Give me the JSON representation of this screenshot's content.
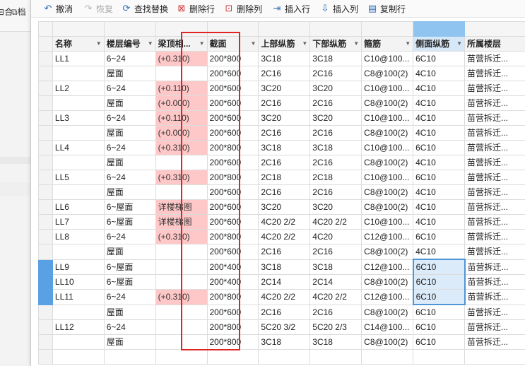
{
  "left_window": {
    "icon1_glyph": "⊟",
    "icon1_char": "合",
    "icon2_glyph": "⧉",
    "icon2_char": "档"
  },
  "toolbar": {
    "undo_label": "撤消",
    "redo_label": "恢复",
    "find_replace_label": "查找替换",
    "delete_row_label": "删除行",
    "delete_col_label": "删除列",
    "insert_row_label": "插入行",
    "insert_col_label": "插入列",
    "copy_row_label": "复制行"
  },
  "grid": {
    "columns": [
      "名称",
      "楼层编号",
      "梁顶相...",
      "截面",
      "上部纵筋",
      "下部纵筋",
      "箍筋",
      "侧面纵筋",
      "所属楼层"
    ],
    "rows": [
      {
        "name": "LL1",
        "floor": "6~24",
        "top_offset": "(+0.310)",
        "section": "200*800",
        "top_bar": "3C18",
        "bottom_bar": "3C18",
        "stirrup": "C10@100...",
        "side_bar": "6C10",
        "belong": "苗营拆迁..."
      },
      {
        "name": "",
        "floor": "屋面",
        "top_offset": "",
        "section": "200*600",
        "top_bar": "2C16",
        "bottom_bar": "2C16",
        "stirrup": "C8@100(2)",
        "side_bar": "4C10",
        "belong": "苗营拆迁..."
      },
      {
        "name": "LL2",
        "floor": "6~24",
        "top_offset": "(+0.110)",
        "section": "200*600",
        "top_bar": "3C20",
        "bottom_bar": "3C20",
        "stirrup": "C10@100...",
        "side_bar": "4C10",
        "belong": "苗营拆迁..."
      },
      {
        "name": "",
        "floor": "屋面",
        "top_offset": "(+0.000)",
        "section": "200*600",
        "top_bar": "2C16",
        "bottom_bar": "2C16",
        "stirrup": "C8@100(2)",
        "side_bar": "4C10",
        "belong": "苗营拆迁..."
      },
      {
        "name": "LL3",
        "floor": "6~24",
        "top_offset": "(+0.110)",
        "section": "200*600",
        "top_bar": "3C20",
        "bottom_bar": "3C20",
        "stirrup": "C10@100...",
        "side_bar": "4C10",
        "belong": "苗营拆迁..."
      },
      {
        "name": "",
        "floor": "屋面",
        "top_offset": "(+0.000)",
        "section": "200*600",
        "top_bar": "2C16",
        "bottom_bar": "2C16",
        "stirrup": "C8@100(2)",
        "side_bar": "4C10",
        "belong": "苗营拆迁..."
      },
      {
        "name": "LL4",
        "floor": "6~24",
        "top_offset": "(+0.310)",
        "section": "200*800",
        "top_bar": "3C18",
        "bottom_bar": "3C18",
        "stirrup": "C10@100...",
        "side_bar": "6C10",
        "belong": "苗营拆迁..."
      },
      {
        "name": "",
        "floor": "屋面",
        "top_offset": "",
        "section": "200*600",
        "top_bar": "2C16",
        "bottom_bar": "2C16",
        "stirrup": "C8@100(2)",
        "side_bar": "4C10",
        "belong": "苗营拆迁..."
      },
      {
        "name": "LL5",
        "floor": "6~24",
        "top_offset": "(+0.310)",
        "section": "200*800",
        "top_bar": "2C18",
        "bottom_bar": "2C18",
        "stirrup": "C10@100...",
        "side_bar": "6C10",
        "belong": "苗营拆迁..."
      },
      {
        "name": "",
        "floor": "屋面",
        "top_offset": "",
        "section": "200*600",
        "top_bar": "2C16",
        "bottom_bar": "2C16",
        "stirrup": "C8@100(2)",
        "side_bar": "4C10",
        "belong": "苗营拆迁..."
      },
      {
        "name": "LL6",
        "floor": "6~屋面",
        "top_offset": "详楼梯图",
        "section": "200*600",
        "top_bar": "3C20",
        "bottom_bar": "3C20",
        "stirrup": "C8@100(2)",
        "side_bar": "4C10",
        "belong": "苗营拆迁..."
      },
      {
        "name": "LL7",
        "floor": "6~屋面",
        "top_offset": "详楼梯图",
        "section": "200*600",
        "top_bar": "4C20 2/2",
        "bottom_bar": "4C20 2/2",
        "stirrup": "C10@100...",
        "side_bar": "4C10",
        "belong": "苗营拆迁..."
      },
      {
        "name": "LL8",
        "floor": "6~24",
        "top_offset": "(+0.310)",
        "section": "200*800",
        "top_bar": "4C20 2/2",
        "bottom_bar": "4C20",
        "stirrup": "C12@100...",
        "side_bar": "6C10",
        "belong": "苗营拆迁..."
      },
      {
        "name": "",
        "floor": "屋面",
        "top_offset": "",
        "section": "200*600",
        "top_bar": "2C16",
        "bottom_bar": "2C16",
        "stirrup": "C8@100(2)",
        "side_bar": "4C10",
        "belong": "苗营拆迁..."
      },
      {
        "name": "LL9",
        "floor": "6~屋面",
        "top_offset": "",
        "section": "200*400",
        "top_bar": "3C18",
        "bottom_bar": "3C18",
        "stirrup": "C12@100...",
        "side_bar": "6C10",
        "belong": "苗营拆迁..."
      },
      {
        "name": "LL10",
        "floor": "6~屋面",
        "top_offset": "",
        "section": "200*400",
        "top_bar": "2C14",
        "bottom_bar": "2C14",
        "stirrup": "C8@100(2)",
        "side_bar": "6C10",
        "belong": "苗营拆迁..."
      },
      {
        "name": "LL11",
        "floor": "6~24",
        "top_offset": "(+0.310)",
        "section": "200*800",
        "top_bar": "4C20 2/2",
        "bottom_bar": "4C20 2/2",
        "stirrup": "C12@100...",
        "side_bar": "6C10",
        "belong": "苗营拆迁..."
      },
      {
        "name": "",
        "floor": "屋面",
        "top_offset": "",
        "section": "200*600",
        "top_bar": "2C16",
        "bottom_bar": "2C16",
        "stirrup": "C8@100(2)",
        "side_bar": "6C10",
        "belong": "苗营拆迁..."
      },
      {
        "name": "LL12",
        "floor": "6~24",
        "top_offset": "",
        "section": "200*800",
        "top_bar": "5C20 3/2",
        "bottom_bar": "5C20 2/3",
        "stirrup": "C14@100...",
        "side_bar": "6C10",
        "belong": "苗营拆迁..."
      },
      {
        "name": "",
        "floor": "屋面",
        "top_offset": "",
        "section": "200*800",
        "top_bar": "3C18",
        "bottom_bar": "3C18",
        "stirrup": "C8@100(2)",
        "side_bar": "6C10",
        "belong": "苗营拆迁..."
      }
    ],
    "pink_rows": [
      0,
      2,
      3,
      4,
      5,
      6,
      8,
      10,
      11,
      12,
      16
    ],
    "selected_rows": [
      14,
      15,
      16
    ]
  },
  "colors": {
    "highlight_pink": "#ffc8c8",
    "selection_blue": "#5aa1e3",
    "annotation_red": "#e02424"
  }
}
